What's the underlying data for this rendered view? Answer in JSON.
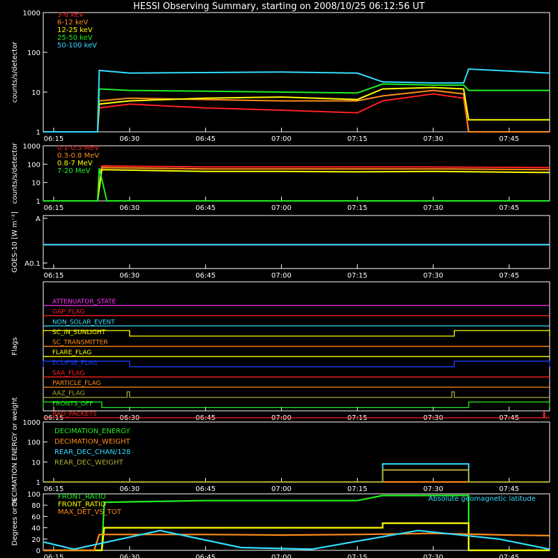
{
  "title": "HESSI Observing Summary, starting on 2008/10/25 06:12:56 UT",
  "time_labels": [
    "06:15",
    "06:30",
    "06:45",
    "07:00",
    "07:15",
    "07:30",
    "07:45"
  ],
  "colors": {
    "background": "#000000",
    "axes": "#ffffff",
    "red": "#ff2020",
    "orange": "#ff8c1a",
    "yellow": "#ffff00",
    "green": "#22ee22",
    "cyan": "#33ddff",
    "magenta": "#ff33ff",
    "blue": "#2040ff",
    "olive": "#aaaa33",
    "darkorange": "#cc6610"
  },
  "chart_data": [
    {
      "type": "line",
      "ylabel": "counts/s/detector",
      "yscale": "log",
      "ylim": [
        1,
        1000
      ],
      "yticks": [
        "1",
        "10",
        "100",
        "1000"
      ],
      "xlim": [
        "06:12:56",
        "07:53:00"
      ],
      "series": [
        {
          "name": "3-6 keV",
          "color": "#ff2020",
          "x": [
            "06:12:56",
            "06:23:40",
            "06:24:00",
            "06:30",
            "06:45",
            "07:00",
            "07:15",
            "07:20",
            "07:30",
            "07:36",
            "07:37",
            "07:53"
          ],
          "values": [
            1,
            1,
            4,
            5,
            4,
            3.5,
            3,
            6,
            9,
            7,
            1,
            1
          ]
        },
        {
          "name": "6-12 keV",
          "color": "#ff8c1a",
          "x": [
            "06:12:56",
            "06:23:40",
            "06:24:00",
            "06:30",
            "06:45",
            "07:00",
            "07:15",
            "07:20",
            "07:30",
            "07:36",
            "07:37",
            "07:53"
          ],
          "values": [
            1,
            1,
            6,
            7,
            6.5,
            6,
            6,
            8,
            11,
            9,
            1,
            1
          ]
        },
        {
          "name": "12-25 keV",
          "color": "#ffff00",
          "x": [
            "06:12:56",
            "06:23:40",
            "06:24:00",
            "06:30",
            "06:45",
            "07:00",
            "07:15",
            "07:20",
            "07:30",
            "07:36",
            "07:37",
            "07:53"
          ],
          "values": [
            1,
            1,
            5,
            6,
            7,
            7.5,
            6.5,
            12,
            13,
            12,
            2,
            2
          ]
        },
        {
          "name": "25-50 keV",
          "color": "#22ee22",
          "x": [
            "06:12:56",
            "06:23:40",
            "06:24:00",
            "06:30",
            "06:45",
            "07:00",
            "07:15",
            "07:20",
            "07:30",
            "07:36",
            "07:37",
            "07:53"
          ],
          "values": [
            1,
            1,
            12,
            11,
            10.5,
            10,
            9.5,
            16,
            15,
            15,
            11,
            11
          ]
        },
        {
          "name": "50-100 keV",
          "color": "#33ddff",
          "x": [
            "06:12:56",
            "06:23:40",
            "06:24:00",
            "06:30",
            "06:45",
            "07:00",
            "07:15",
            "07:20",
            "07:30",
            "07:36",
            "07:37",
            "07:53"
          ],
          "values": [
            1,
            1,
            35,
            30,
            31,
            32,
            30,
            18,
            17,
            17,
            38,
            30
          ]
        }
      ]
    },
    {
      "type": "line",
      "ylabel": "counts/s/detector",
      "yscale": "log",
      "ylim": [
        1,
        1000
      ],
      "yticks": [
        "1",
        "10",
        "100",
        "1000"
      ],
      "series": [
        {
          "name": "0.1-0.3 MeV",
          "color": "#ff2020",
          "x": [
            "06:12:56",
            "06:23:40",
            "06:24:30",
            "06:45",
            "07:00",
            "07:15",
            "07:30",
            "07:53"
          ],
          "values": [
            1,
            1,
            80,
            70,
            70,
            70,
            70,
            65
          ]
        },
        {
          "name": "0.3-0.8 MeV",
          "color": "#ff8c1a",
          "x": [
            "06:12:56",
            "06:23:40",
            "06:24:30",
            "06:45",
            "07:00",
            "07:15",
            "07:30",
            "07:53"
          ],
          "values": [
            1,
            1,
            65,
            55,
            55,
            55,
            55,
            50
          ]
        },
        {
          "name": "0.8-7 MeV",
          "color": "#ffff00",
          "x": [
            "06:12:56",
            "06:23:40",
            "06:24:30",
            "06:45",
            "07:00",
            "07:15",
            "07:30",
            "07:53"
          ],
          "values": [
            1,
            1,
            50,
            40,
            40,
            38,
            40,
            35
          ]
        },
        {
          "name": "7-20 MeV",
          "color": "#22ee22",
          "x": [
            "06:12:56",
            "06:23:40",
            "06:24:00",
            "06:25:30",
            "07:53"
          ],
          "values": [
            1,
            1,
            60,
            1,
            1
          ]
        }
      ]
    },
    {
      "type": "line",
      "ylabel": "GOES-10 [W m⁻²]",
      "yticks": [
        "A0.1",
        "A"
      ],
      "series": [
        {
          "color": "#ff33ff",
          "x": [
            "06:12:56",
            "07:53"
          ],
          "values": [
            0.45,
            0.45
          ]
        },
        {
          "color": "#33ddff",
          "x": [
            "06:12:56",
            "07:53"
          ],
          "values": [
            0.45,
            0.45
          ]
        }
      ]
    },
    {
      "type": "line",
      "ylabel": "Flags",
      "flags": [
        {
          "name": "ATTENUATOR_STATE",
          "color": "#ff33ff",
          "on": []
        },
        {
          "name": "GAP_FLAG",
          "color": "#ff2020",
          "on": []
        },
        {
          "name": "NON_SOLAR_EVENT",
          "color": "#33ddff",
          "on": []
        },
        {
          "name": "SC_IN_SUNLIGHT",
          "color": "#ffff00",
          "on": [
            [
              "06:12:56",
              "06:30:00"
            ],
            [
              "07:34:10",
              "07:53:00"
            ]
          ]
        },
        {
          "name": "SC_TRANSMITTER",
          "color": "#ff8c1a",
          "on": []
        },
        {
          "name": "FLARE_FLAG",
          "color": "#ffff00",
          "on": []
        },
        {
          "name": "ECLIPSE_FLAG",
          "color": "#2040ff",
          "on": [
            [
              "06:12:56",
              "06:30:00"
            ],
            [
              "07:34:10",
              "07:53:00"
            ]
          ]
        },
        {
          "name": "SAA_FLAG",
          "color": "#ff2020",
          "on": []
        },
        {
          "name": "PARTICLE_FLAG",
          "color": "#ff8c1a",
          "on": []
        },
        {
          "name": "AAZ_FLAG",
          "color": "#aaaa33",
          "on": [
            [
              "06:29:30",
              "06:30:00"
            ],
            [
              "07:33:40",
              "07:34:10"
            ]
          ]
        },
        {
          "name": "FRONTS_OFF",
          "color": "#22ee22",
          "on": [
            [
              "06:12:56",
              "06:24:30"
            ],
            [
              "07:37:00",
              "07:53:00"
            ]
          ]
        },
        {
          "name": "BAD_PACKETS",
          "color": "#ff2020",
          "on": [
            [
              "07:51:50",
              "07:52:00"
            ]
          ]
        }
      ]
    },
    {
      "type": "line",
      "ylabel": "DECIMATION ENERGY or weight",
      "yscale": "log",
      "ylim": [
        1,
        1000
      ],
      "yticks": [
        "1",
        "10",
        "100",
        "1000"
      ],
      "series": [
        {
          "name": "DECIMATION_ENERGY",
          "color": "#22ee22",
          "x": [
            "06:12:56",
            "07:53"
          ],
          "values": [
            1,
            1
          ]
        },
        {
          "name": "DECIMATION_WEIGHT",
          "color": "#ff8c1a",
          "x": [
            "06:12:56",
            "07:53"
          ],
          "values": [
            1,
            1
          ]
        },
        {
          "name": "REAR_DEC_CHAN/128",
          "color": "#33ddff",
          "x": [
            "06:12:56",
            "07:20",
            "07:20",
            "07:37",
            "07:37",
            "07:53"
          ],
          "values": [
            1,
            1,
            8,
            8,
            1,
            1
          ]
        },
        {
          "name": "REAR_DEC_WEIGHT",
          "color": "#aaaa33",
          "x": [
            "06:12:56",
            "07:20",
            "07:20",
            "07:37",
            "07:37",
            "07:53"
          ],
          "values": [
            1,
            1,
            4,
            4,
            1,
            1
          ]
        }
      ]
    },
    {
      "type": "line",
      "ylabel": "Degrees or %",
      "ylim": [
        0,
        100
      ],
      "yticks": [
        "0",
        "20",
        "40",
        "60",
        "80",
        "100"
      ],
      "annotations": [
        "Absolute geomagnetic latitude"
      ],
      "series": [
        {
          "name": "FRONT_RATIO",
          "color": "#22ee22",
          "x": [
            "06:12:56",
            "06:24:30",
            "06:25",
            "06:45",
            "07:00",
            "07:15",
            "07:20",
            "07:30",
            "07:37",
            "07:37",
            "07:53"
          ],
          "values": [
            0,
            0,
            85,
            88,
            88,
            88,
            97,
            97,
            97,
            0,
            0
          ]
        },
        {
          "name": "FRONT_RATIO",
          "color": "#ffff00",
          "x": [
            "06:12:56",
            "06:24:30",
            "06:25",
            "07:20",
            "07:20",
            "07:37",
            "07:37",
            "07:53"
          ],
          "values": [
            0,
            0,
            40,
            40,
            48,
            48,
            0,
            0
          ]
        },
        {
          "name": "MAX_DET_VS_TOT",
          "color": "#ff8c1a",
          "x": [
            "06:12:56",
            "06:23",
            "06:24",
            "06:45",
            "07:00",
            "07:15",
            "07:30",
            "07:45",
            "07:53"
          ],
          "values": [
            0,
            0,
            28,
            28,
            27,
            28,
            30,
            27,
            26
          ]
        },
        {
          "name": "Absolute geomagnetic latitude",
          "color": "#33ddff",
          "x": [
            "06:12:56",
            "06:19",
            "06:36",
            "06:52",
            "07:06",
            "07:27",
            "07:43",
            "07:53"
          ],
          "values": [
            15,
            2,
            35,
            5,
            2,
            35,
            20,
            2
          ]
        }
      ]
    }
  ]
}
